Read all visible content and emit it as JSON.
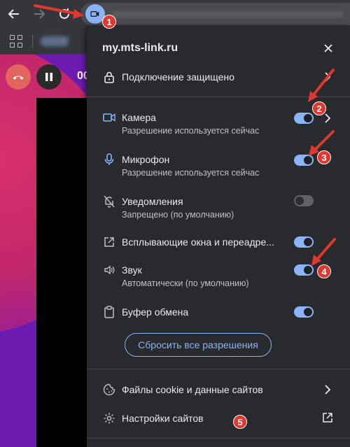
{
  "browser": {
    "back_icon": "arrow-left-icon",
    "forward_icon": "arrow-right-icon",
    "reload_icon": "reload-icon",
    "site_info_icon": "camera-icon"
  },
  "page": {
    "timer": "00"
  },
  "popup": {
    "title": "my.mts-link.ru",
    "connection": "Подключение защищено",
    "permissions": [
      {
        "key": "camera",
        "title": "Камера",
        "sub": "Разрешение используется сейчас",
        "on": true,
        "icon": "camera-icon"
      },
      {
        "key": "microphone",
        "title": "Микрофон",
        "sub": "Разрешение используется сейчас",
        "on": true,
        "icon": "microphone-icon"
      },
      {
        "key": "notifications",
        "title": "Уведомления",
        "sub": "Запрещено (по умолчанию)",
        "on": false,
        "icon": "bell-off-icon"
      },
      {
        "key": "popups",
        "title": "Всплывающие окна и переадре...",
        "sub": "",
        "on": true,
        "icon": "external-window-icon"
      },
      {
        "key": "sound",
        "title": "Звук",
        "sub": "Автоматически (по умолчанию)",
        "on": true,
        "icon": "speaker-icon"
      },
      {
        "key": "clipboard",
        "title": "Буфер обмена",
        "sub": "",
        "on": true,
        "icon": "clipboard-icon"
      }
    ],
    "reset_label": "Сбросить все разрешения",
    "cookies_label": "Файлы cookie и данные сайтов",
    "site_settings_label": "Настройки сайтов"
  },
  "annotations": {
    "badges": [
      "1",
      "2",
      "3",
      "4",
      "5"
    ],
    "color": "#e0372f"
  },
  "colors": {
    "accent": "#8ab4f8",
    "popup_bg": "#292a2d",
    "end_call": "#e2655f"
  }
}
